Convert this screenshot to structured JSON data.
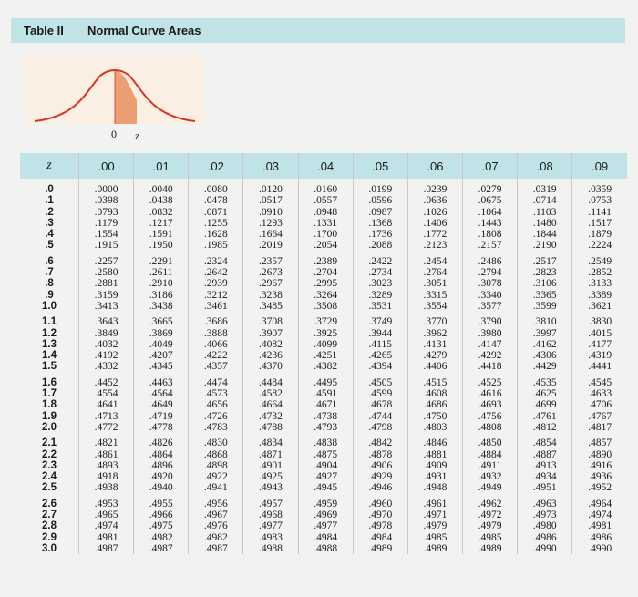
{
  "header": {
    "table_label": "Table II",
    "title": "Normal Curve Areas"
  },
  "figure": {
    "zero_label": "0",
    "z_label": "z",
    "curve_color": "#d8321f",
    "fill_color": "#eb9e72"
  },
  "table": {
    "columns": [
      "z",
      ".00",
      ".01",
      ".02",
      ".03",
      ".04",
      ".05",
      ".06",
      ".07",
      ".08",
      ".09"
    ],
    "rows": [
      [
        ".0",
        ".0000",
        ".0040",
        ".0080",
        ".0120",
        ".0160",
        ".0199",
        ".0239",
        ".0279",
        ".0319",
        ".0359"
      ],
      [
        ".1",
        ".0398",
        ".0438",
        ".0478",
        ".0517",
        ".0557",
        ".0596",
        ".0636",
        ".0675",
        ".0714",
        ".0753"
      ],
      [
        ".2",
        ".0793",
        ".0832",
        ".0871",
        ".0910",
        ".0948",
        ".0987",
        ".1026",
        ".1064",
        ".1103",
        ".1141"
      ],
      [
        ".3",
        ".1179",
        ".1217",
        ".1255",
        ".1293",
        ".1331",
        ".1368",
        ".1406",
        ".1443",
        ".1480",
        ".1517"
      ],
      [
        ".4",
        ".1554",
        ".1591",
        ".1628",
        ".1664",
        ".1700",
        ".1736",
        ".1772",
        ".1808",
        ".1844",
        ".1879"
      ],
      [
        ".5",
        ".1915",
        ".1950",
        ".1985",
        ".2019",
        ".2054",
        ".2088",
        ".2123",
        ".2157",
        ".2190",
        ".2224"
      ],
      [
        ".6",
        ".2257",
        ".2291",
        ".2324",
        ".2357",
        ".2389",
        ".2422",
        ".2454",
        ".2486",
        ".2517",
        ".2549"
      ],
      [
        ".7",
        ".2580",
        ".2611",
        ".2642",
        ".2673",
        ".2704",
        ".2734",
        ".2764",
        ".2794",
        ".2823",
        ".2852"
      ],
      [
        ".8",
        ".2881",
        ".2910",
        ".2939",
        ".2967",
        ".2995",
        ".3023",
        ".3051",
        ".3078",
        ".3106",
        ".3133"
      ],
      [
        ".9",
        ".3159",
        ".3186",
        ".3212",
        ".3238",
        ".3264",
        ".3289",
        ".3315",
        ".3340",
        ".3365",
        ".3389"
      ],
      [
        "1.0",
        ".3413",
        ".3438",
        ".3461",
        ".3485",
        ".3508",
        ".3531",
        ".3554",
        ".3577",
        ".3599",
        ".3621"
      ],
      [
        "1.1",
        ".3643",
        ".3665",
        ".3686",
        ".3708",
        ".3729",
        ".3749",
        ".3770",
        ".3790",
        ".3810",
        ".3830"
      ],
      [
        "1.2",
        ".3849",
        ".3869",
        ".3888",
        ".3907",
        ".3925",
        ".3944",
        ".3962",
        ".3980",
        ".3997",
        ".4015"
      ],
      [
        "1.3",
        ".4032",
        ".4049",
        ".4066",
        ".4082",
        ".4099",
        ".4115",
        ".4131",
        ".4147",
        ".4162",
        ".4177"
      ],
      [
        "1.4",
        ".4192",
        ".4207",
        ".4222",
        ".4236",
        ".4251",
        ".4265",
        ".4279",
        ".4292",
        ".4306",
        ".4319"
      ],
      [
        "1.5",
        ".4332",
        ".4345",
        ".4357",
        ".4370",
        ".4382",
        ".4394",
        ".4406",
        ".4418",
        ".4429",
        ".4441"
      ],
      [
        "1.6",
        ".4452",
        ".4463",
        ".4474",
        ".4484",
        ".4495",
        ".4505",
        ".4515",
        ".4525",
        ".4535",
        ".4545"
      ],
      [
        "1.7",
        ".4554",
        ".4564",
        ".4573",
        ".4582",
        ".4591",
        ".4599",
        ".4608",
        ".4616",
        ".4625",
        ".4633"
      ],
      [
        "1.8",
        ".4641",
        ".4649",
        ".4656",
        ".4664",
        ".4671",
        ".4678",
        ".4686",
        ".4693",
        ".4699",
        ".4706"
      ],
      [
        "1.9",
        ".4713",
        ".4719",
        ".4726",
        ".4732",
        ".4738",
        ".4744",
        ".4750",
        ".4756",
        ".4761",
        ".4767"
      ],
      [
        "2.0",
        ".4772",
        ".4778",
        ".4783",
        ".4788",
        ".4793",
        ".4798",
        ".4803",
        ".4808",
        ".4812",
        ".4817"
      ],
      [
        "2.1",
        ".4821",
        ".4826",
        ".4830",
        ".4834",
        ".4838",
        ".4842",
        ".4846",
        ".4850",
        ".4854",
        ".4857"
      ],
      [
        "2.2",
        ".4861",
        ".4864",
        ".4868",
        ".4871",
        ".4875",
        ".4878",
        ".4881",
        ".4884",
        ".4887",
        ".4890"
      ],
      [
        "2.3",
        ".4893",
        ".4896",
        ".4898",
        ".4901",
        ".4904",
        ".4906",
        ".4909",
        ".4911",
        ".4913",
        ".4916"
      ],
      [
        "2.4",
        ".4918",
        ".4920",
        ".4922",
        ".4925",
        ".4927",
        ".4929",
        ".4931",
        ".4932",
        ".4934",
        ".4936"
      ],
      [
        "2.5",
        ".4938",
        ".4940",
        ".4941",
        ".4943",
        ".4945",
        ".4946",
        ".4948",
        ".4949",
        ".4951",
        ".4952"
      ],
      [
        "2.6",
        ".4953",
        ".4955",
        ".4956",
        ".4957",
        ".4959",
        ".4960",
        ".4961",
        ".4962",
        ".4963",
        ".4964"
      ],
      [
        "2.7",
        ".4965",
        ".4966",
        ".4967",
        ".4968",
        ".4969",
        ".4970",
        ".4971",
        ".4972",
        ".4973",
        ".4974"
      ],
      [
        "2.8",
        ".4974",
        ".4975",
        ".4976",
        ".4977",
        ".4977",
        ".4978",
        ".4979",
        ".4979",
        ".4980",
        ".4981"
      ],
      [
        "2.9",
        ".4981",
        ".4982",
        ".4982",
        ".4983",
        ".4984",
        ".4984",
        ".4985",
        ".4985",
        ".4986",
        ".4986"
      ],
      [
        "3.0",
        ".4987",
        ".4987",
        ".4987",
        ".4988",
        ".4988",
        ".4989",
        ".4989",
        ".4989",
        ".4990",
        ".4990"
      ]
    ]
  }
}
